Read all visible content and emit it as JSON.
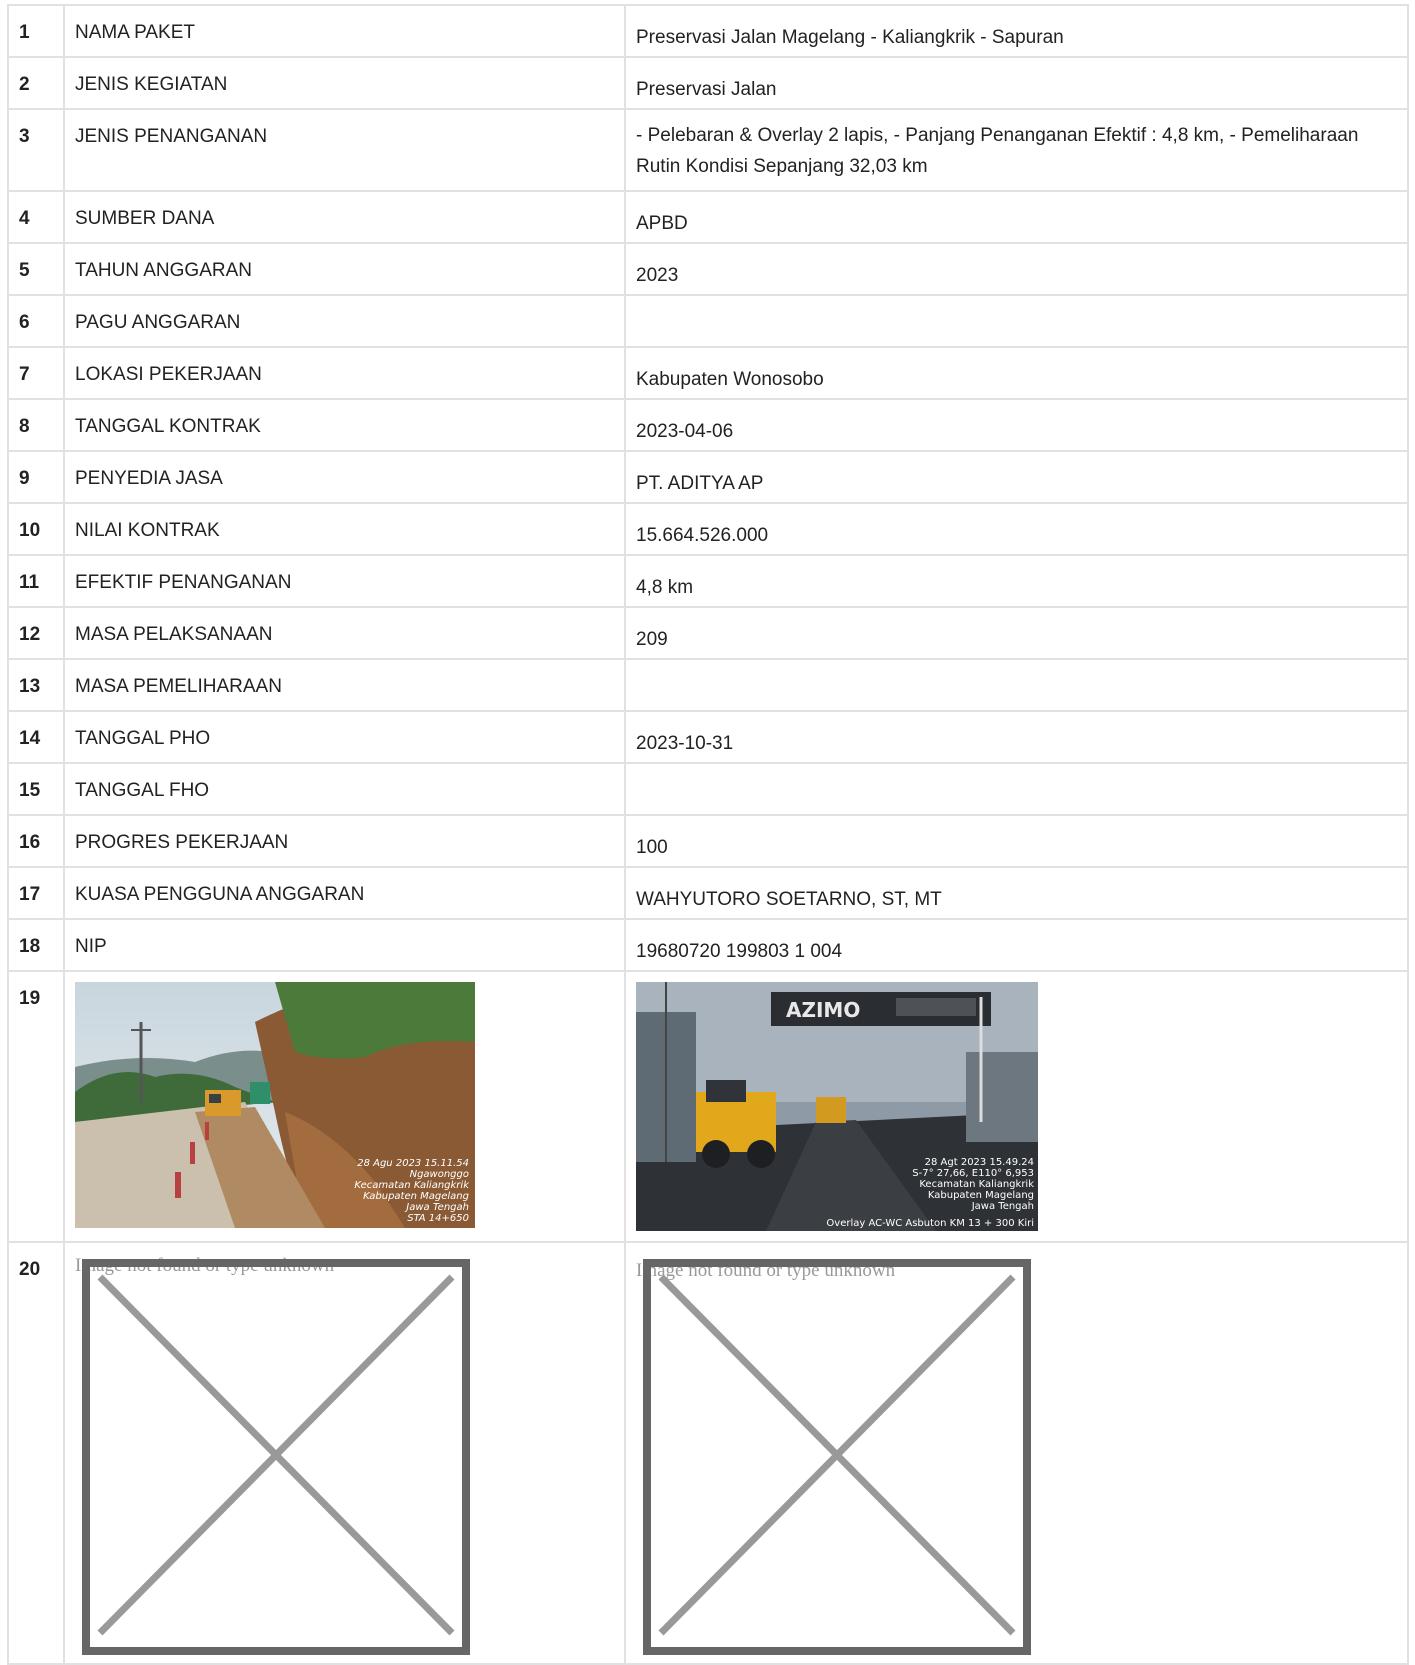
{
  "rows": [
    {
      "no": "1",
      "label": "NAMA PAKET",
      "value": "Preservasi Jalan Magelang - Kaliangkrik - Sapuran"
    },
    {
      "no": "2",
      "label": "JENIS KEGIATAN",
      "value": "Preservasi Jalan"
    },
    {
      "no": "3",
      "label": "JENIS PENANGANAN",
      "value": "- Pelebaran & Overlay 2 lapis, - Panjang Penanganan Efektif : 4,8 km, - Pemeliharaan Rutin Kondisi Sepanjang 32,03 km"
    },
    {
      "no": "4",
      "label": "SUMBER DANA",
      "value": "APBD"
    },
    {
      "no": "5",
      "label": "TAHUN ANGGARAN",
      "value": "2023"
    },
    {
      "no": "6",
      "label": "PAGU ANGGARAN",
      "value": ""
    },
    {
      "no": "7",
      "label": "LOKASI PEKERJAAN",
      "value": "Kabupaten Wonosobo"
    },
    {
      "no": "8",
      "label": "TANGGAL KONTRAK",
      "value": "2023-04-06"
    },
    {
      "no": "9",
      "label": "PENYEDIA JASA",
      "value": "PT. ADITYA AP"
    },
    {
      "no": "10",
      "label": "NILAI KONTRAK",
      "value": "15.664.526.000"
    },
    {
      "no": "11",
      "label": "EFEKTIF PENANGANAN",
      "value": "4,8 km"
    },
    {
      "no": "12",
      "label": "MASA PELAKSANAAN",
      "value": "209"
    },
    {
      "no": "13",
      "label": "MASA PEMELIHARAAN",
      "value": ""
    },
    {
      "no": "14",
      "label": "TANGGAL PHO",
      "value": "2023-10-31"
    },
    {
      "no": "15",
      "label": "TANGGAL FHO",
      "value": ""
    },
    {
      "no": "16",
      "label": "PROGRES PEKERJAAN",
      "value": "100"
    },
    {
      "no": "17",
      "label": "KUASA PENGGUNA ANGGARAN",
      "value": "WAHYUTORO SOETARNO, ST, MT"
    },
    {
      "no": "18",
      "label": "NIP",
      "value": "19680720 199803 1 004"
    }
  ],
  "photo_row": {
    "no": "19",
    "photo_left": {
      "stamp": [
        "28 Agu 2023 15.11.54",
        "Ngawonggo",
        "Kecamatan Kaliangkrik",
        "Kabupaten Magelang",
        "Jawa Tengah",
        "STA 14+650"
      ]
    },
    "photo_right": {
      "sign": "AZIMO",
      "stamp": [
        "28 Agt 2023 15.49.24",
        "S-7° 27,66, E110° 6,953",
        "Kecamatan Kaliangkrik",
        "Kabupaten Magelang",
        "Jawa Tengah",
        "Overlay AC-WC Asbuton KM 13 + 300 Kiri"
      ]
    }
  },
  "broken_row": {
    "no": "20",
    "alt_text": "Image not found or type unknown"
  },
  "colors": {
    "border": "#e1e1e1",
    "broken_frame": "#666666",
    "broken_cross": "#999999"
  }
}
